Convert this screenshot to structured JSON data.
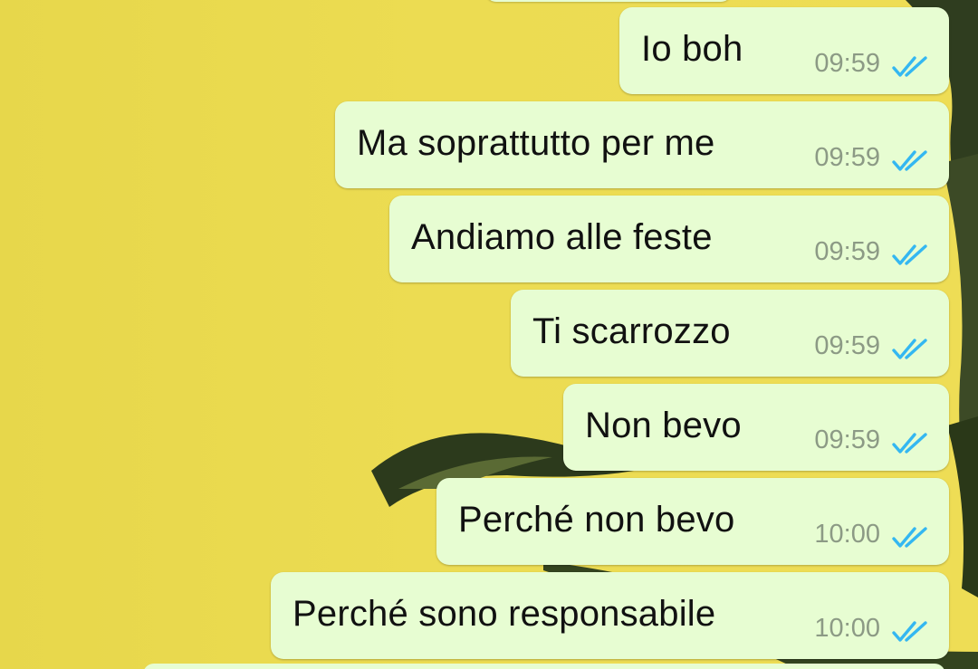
{
  "colors": {
    "wallpaper": "#eadb50",
    "outgoing_bubble": "#e7fdd2",
    "read_ticks": "#34b7f1",
    "timestamp": "#8c9a85"
  },
  "messages": [
    {
      "text": "Io boh",
      "time": "09:59",
      "status_icon": "double-check-read-icon"
    },
    {
      "text": "Ma soprattutto per me",
      "time": "09:59",
      "status_icon": "double-check-read-icon"
    },
    {
      "text": "Andiamo alle feste",
      "time": "09:59",
      "status_icon": "double-check-read-icon"
    },
    {
      "text": "Ti scarrozzo",
      "time": "09:59",
      "status_icon": "double-check-read-icon"
    },
    {
      "text": "Non bevo",
      "time": "09:59",
      "status_icon": "double-check-read-icon"
    },
    {
      "text": "Perché non bevo",
      "time": "10:00",
      "status_icon": "double-check-read-icon"
    },
    {
      "text": "Perché sono responsabile",
      "time": "10:00",
      "status_icon": "double-check-read-icon"
    }
  ]
}
